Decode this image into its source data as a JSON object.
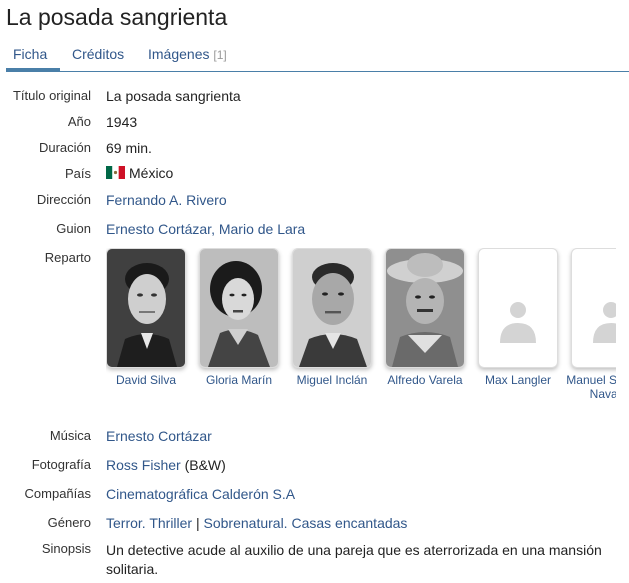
{
  "title": "La posada sangrienta",
  "tabs": [
    {
      "label": "Ficha",
      "active": true
    },
    {
      "label": "Créditos",
      "active": false
    },
    {
      "label": "Imágenes",
      "count": "[1]",
      "active": false
    }
  ],
  "fields": {
    "titulo_original": {
      "label": "Título original",
      "value": "La posada sangrienta"
    },
    "anio": {
      "label": "Año",
      "value": "1943"
    },
    "duracion": {
      "label": "Duración",
      "value": "69 min."
    },
    "pais": {
      "label": "País",
      "value": "México",
      "flag_icon": "mexico-flag-icon"
    },
    "direccion": {
      "label": "Dirección",
      "links": [
        "Fernando A. Rivero"
      ]
    },
    "guion": {
      "label": "Guion",
      "links": [
        "Ernesto Cortázar",
        "Mario de Lara"
      ],
      "separator": ", "
    },
    "reparto": {
      "label": "Reparto"
    },
    "musica": {
      "label": "Música",
      "links": [
        "Ernesto Cortázar"
      ]
    },
    "fotografia": {
      "label": "Fotografía",
      "links": [
        "Ross Fisher"
      ],
      "suffix": " (B&W)"
    },
    "companias": {
      "label": "Compañías",
      "links": [
        "Cinematográfica Calderón S.A"
      ]
    },
    "genero": {
      "label": "Género",
      "links": [
        "Terror. Thriller",
        "Sobrenatural. Casas encantadas"
      ],
      "separator": " | "
    },
    "sinopsis": {
      "label": "Sinopsis",
      "value": "Un detective acude al auxilio de una pareja que es aterrorizada en una mansión solitaria."
    }
  },
  "cast": [
    {
      "name": "David Silva",
      "photo": true
    },
    {
      "name": "Gloria Marín",
      "photo": true
    },
    {
      "name": "Miguel Inclán",
      "photo": true
    },
    {
      "name": "Alfredo Varela",
      "photo": true
    },
    {
      "name": "Max Langler",
      "photo": false
    },
    {
      "name": "Manuel Sánchez Navarro",
      "photo": false
    }
  ],
  "colors": {
    "link": "#31578a",
    "tab_border": "#4a7fa8",
    "placeholder": "#d4d4d4"
  }
}
